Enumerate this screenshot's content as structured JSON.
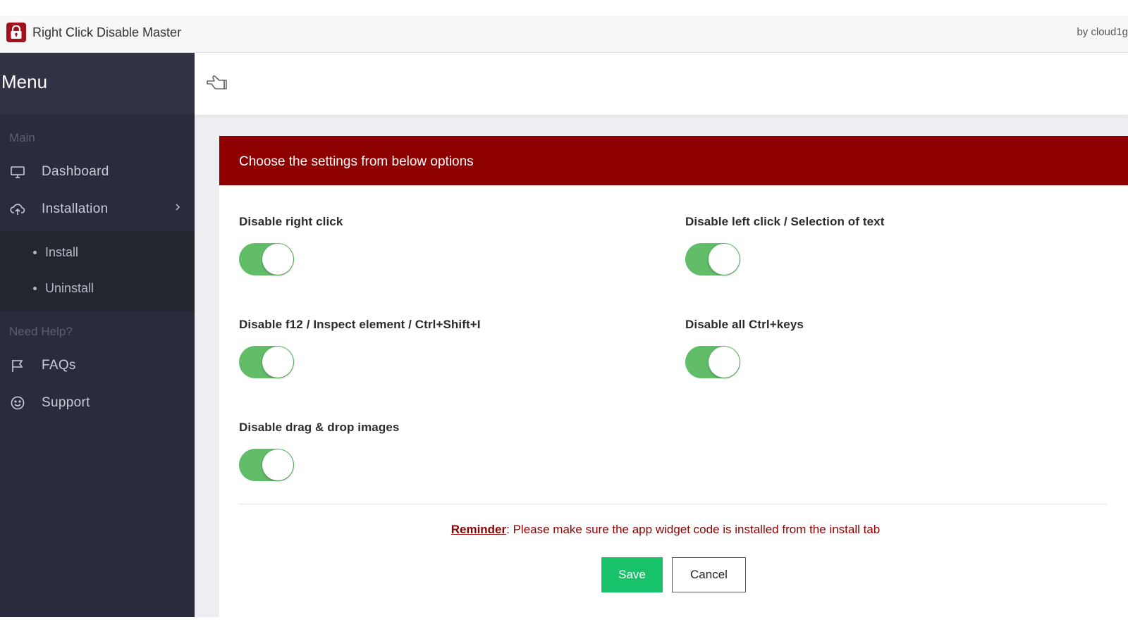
{
  "window": {
    "title": "Right Click Disable Master",
    "byline": "by cloud1g",
    "icon": "lock-icon",
    "accent": "#a3101c"
  },
  "sidebar": {
    "title": "Menu",
    "background": "#2a2c3d",
    "sections": [
      {
        "label": "Main",
        "items": [
          {
            "label": "Dashboard",
            "icon": "monitor-icon"
          },
          {
            "label": "Installation",
            "icon": "cloud-upload-icon",
            "expanded": true,
            "children": [
              {
                "label": "Install"
              },
              {
                "label": "Uninstall"
              }
            ]
          }
        ]
      },
      {
        "label": "Need Help?",
        "items": [
          {
            "label": "FAQs",
            "icon": "flag-icon"
          },
          {
            "label": "Support",
            "icon": "smile-icon"
          }
        ]
      }
    ]
  },
  "header": {
    "toggle_icon": "hand-pointer-icon"
  },
  "panel": {
    "title": "Choose the settings from below options",
    "header_color": "#8e0000",
    "options": [
      {
        "label": "Disable right click",
        "enabled": true
      },
      {
        "label": "Disable left click / Selection of text",
        "enabled": true
      },
      {
        "label": "Disable f12 / Inspect element / Ctrl+Shift+I",
        "enabled": true
      },
      {
        "label": "Disable all Ctrl+keys",
        "enabled": true
      },
      {
        "label": "Disable drag & drop images",
        "enabled": true
      }
    ],
    "toggle_on_color": "#62bd69",
    "reminder": {
      "label": "Reminder",
      "text": ": Please make sure the app widget code is installed from the install tab"
    },
    "buttons": {
      "save": "Save",
      "cancel": "Cancel",
      "save_color": "#19c36b"
    }
  }
}
